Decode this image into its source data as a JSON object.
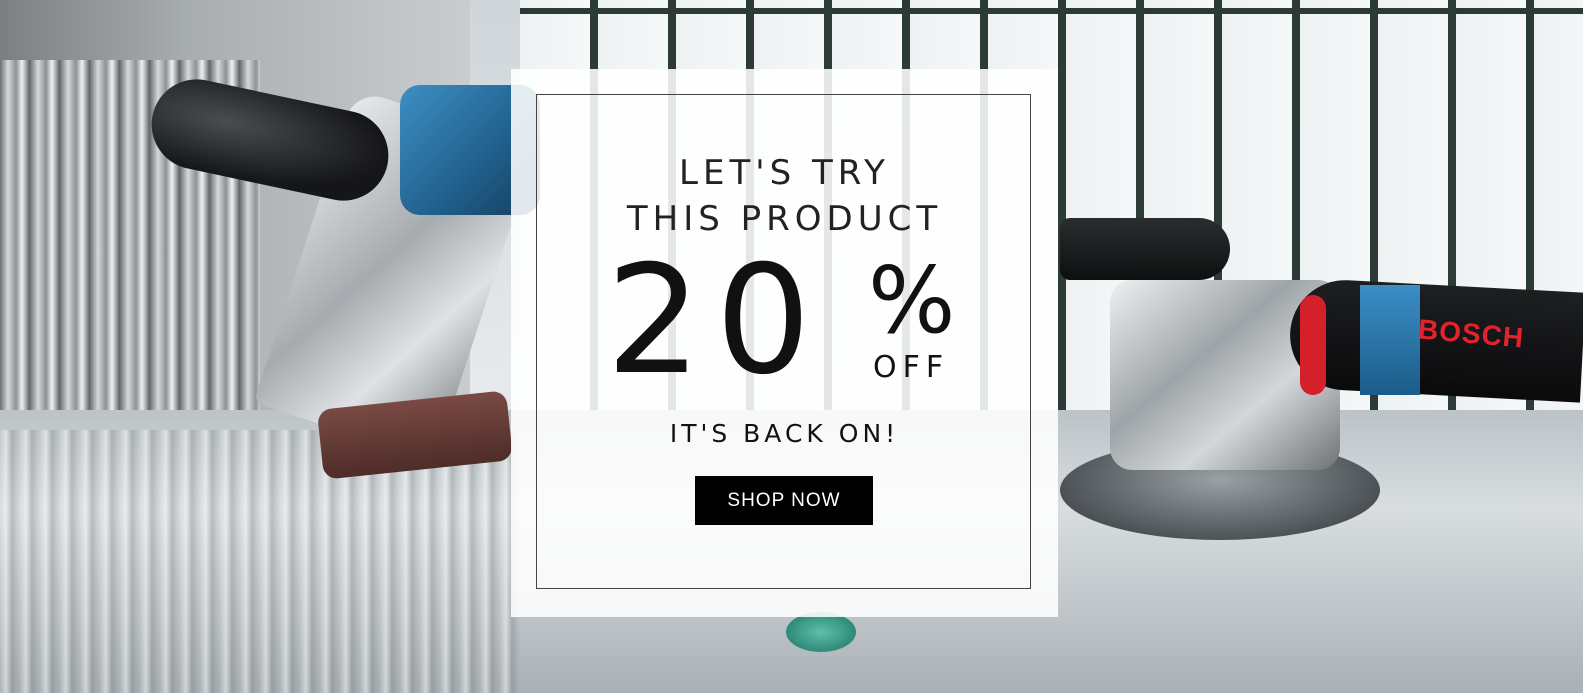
{
  "promo": {
    "heading_line_1": "LET'S TRY",
    "heading_line_2": "THIS PRODUCT",
    "discount_value": "20",
    "discount_symbol": "%",
    "discount_suffix": "OFF",
    "subheading": "IT'S BACK ON!",
    "cta_label": "SHOP NOW"
  },
  "background": {
    "brand_logo_text": "BOSCH",
    "description_icon": "power-tools-photo"
  },
  "colors": {
    "card_background": "#ffffff",
    "button_background": "#000000",
    "button_text": "#ffffff",
    "brand_red": "#e3232c",
    "tool_blue": "#1f5f8c"
  }
}
